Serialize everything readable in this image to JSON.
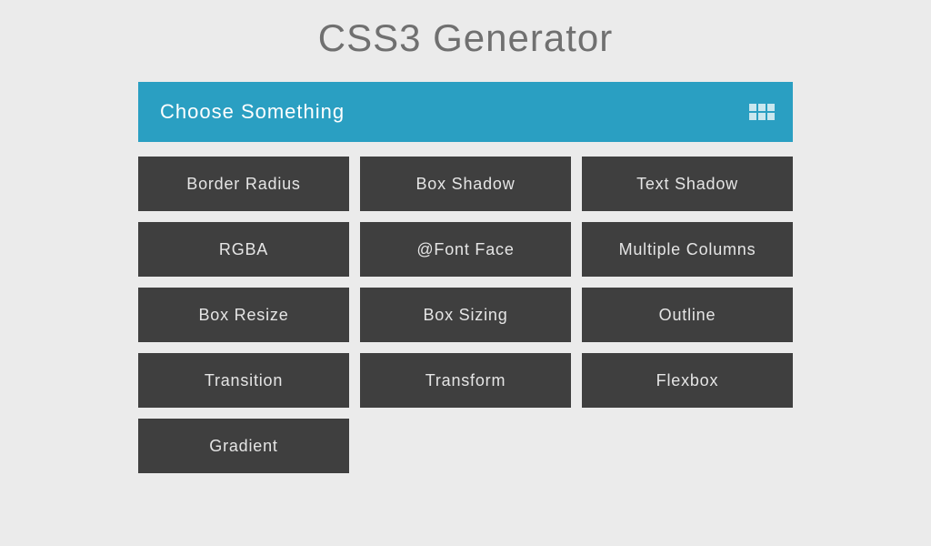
{
  "title": "CSS3 Generator",
  "chooseBar": {
    "label": "Choose Something"
  },
  "colors": {
    "background": "#ebebeb",
    "bar": "#2a9fc2",
    "button": "#3f3f3f",
    "titleText": "#707070"
  },
  "options": [
    {
      "label": "Border Radius",
      "name": "option-border-radius"
    },
    {
      "label": "Box Shadow",
      "name": "option-box-shadow"
    },
    {
      "label": "Text Shadow",
      "name": "option-text-shadow"
    },
    {
      "label": "RGBA",
      "name": "option-rgba"
    },
    {
      "label": "@Font Face",
      "name": "option-font-face"
    },
    {
      "label": "Multiple Columns",
      "name": "option-multiple-columns"
    },
    {
      "label": "Box Resize",
      "name": "option-box-resize"
    },
    {
      "label": "Box Sizing",
      "name": "option-box-sizing"
    },
    {
      "label": "Outline",
      "name": "option-outline"
    },
    {
      "label": "Transition",
      "name": "option-transition"
    },
    {
      "label": "Transform",
      "name": "option-transform"
    },
    {
      "label": "Flexbox",
      "name": "option-flexbox"
    },
    {
      "label": "Gradient",
      "name": "option-gradient"
    }
  ]
}
